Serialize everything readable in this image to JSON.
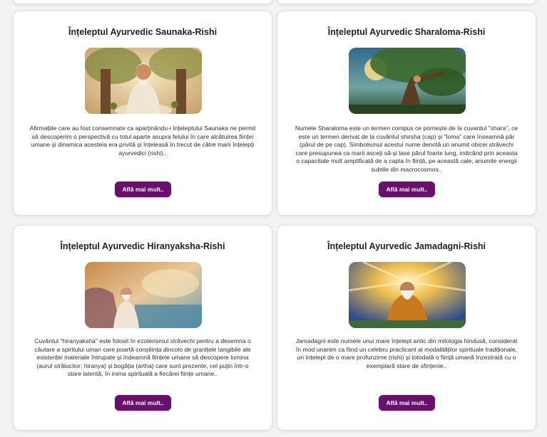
{
  "cards": [
    {
      "title": "Înțeleptul Ayurvedic Saunaka-Rishi",
      "description": "Afirmațiile care au fost consemnate ca aparținându-i înțeleptului Saunaka ne permit să descoperim o perspectivă cu totul aparte asupra felului în care alcătuirea ființei umane și dinamica acesteia era privită și înțeleasă în trecut de către marii înțelepți ayurvedici (rishi)..",
      "button_label": "Află mai mult..",
      "image_icon": "sage-under-tree-image"
    },
    {
      "title": "Înțeleptul Ayurvedic Sharaloma-Rishi",
      "description": "Numele Sharaloma este un termen compus ce pornește de la cuvantul \"shara\", ce este un termen derivat de la cuvântul shirsha (cap) și \"loma\" care înseamnă păr (părul de pe cap). Simbolismul acestui nume denotă un anumit obicei străvechi care presupunea ca marii asceți să-și lase părul foarte lung, indicând prin aceasta o capacitate mult amplificată de a capta în ființă, pe această cale, anumite energii subtile din macrocosmos..",
      "button_label": "Află mai mult..",
      "image_icon": "sage-in-tree-image"
    },
    {
      "title": "Înțeleptul Ayurvedic Hiranyaksha-Rishi",
      "description": "Cuvântul \"hiranyaksha\" este folosit în ezoterismul străvechi pentru a desemna o căutare a spiritului uman care poartă conștiința dincolo de granițele tangibile ale existenței materiale întrupate și îndeamnă ființele umane să descopere lumina (aurul strălucitor; hiranya) și bogăția (artha) care sunt prezente, cel puțin într-o stare latentă, în inima spirituală a fiecărei ființe umane..",
      "button_label": "Află mai mult..",
      "image_icon": "sage-by-lake-image"
    },
    {
      "title": "Înțeleptul Ayurvedic Jamadagni-Rishi",
      "description": "Jamadagni este numele unui mare înțelept antic din mitologia hindusă, considerat în mod unanim ca fiind un celebru practicant al modalităților spirituale tradiționale, un înțelept de o mare profunzime (rishi) și totodată o ființă umană înzestrată cu o exemplară stare de sfințenie..",
      "button_label": "Află mai mult..",
      "image_icon": "sage-in-light-image"
    }
  ],
  "colors": {
    "button_bg": "#6a0f6e",
    "page_bg": "#f3f3f3",
    "card_bg": "#ffffff"
  }
}
